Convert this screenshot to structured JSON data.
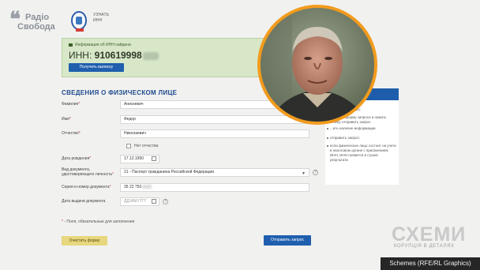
{
  "header": {
    "logo_line1": "Радіо",
    "logo_line2": "Свобода",
    "service_line1": "УЗНАТЬ",
    "service_line2": "ИНН"
  },
  "info_box": {
    "title": "Информация об ИНН найдена",
    "inn_label": "ИНН:",
    "inn_value": "910619998",
    "button": "Получить выписку"
  },
  "form": {
    "section_title": "СВЕДЕНИЯ О ФИЗИЧЕСКОМ ЛИЦЕ",
    "fields": [
      {
        "label": "Фамилия",
        "value": "Анискевич"
      },
      {
        "label": "Имя",
        "value": "Федор"
      },
      {
        "label": "Отчество",
        "value": "Николаевич"
      },
      {
        "label": "Дата рождения",
        "value": "17.12.1950"
      },
      {
        "label": "Вид документа, удостоверяющего личность",
        "value": "21 - Паспорт гражданина Российской Федерации"
      },
      {
        "label": "Серия и номер документа",
        "value": "35 22 750"
      },
      {
        "label": "Дата выдачи документа",
        "value": "ДД.ММ.ГГГГ"
      }
    ],
    "no_patronymic": "Нет отчества",
    "required_note": "- Поля, обязательные для заполнения",
    "clear_button": "Очистить форму",
    "submit_button": "Отправить запрос"
  },
  "sidebar": {
    "items": [
      "...узнать ИНН",
      "...ица необходимо:",
      "...олнить форму запроса и нажать кнопку отправить запрос",
      "...ить наличие информации",
      "отправить запрос;",
      "если физическое лицо состоит на учете в налоговом органе с присвоением ИНН, ИНН появится в строке результата"
    ]
  },
  "watermark": {
    "logo": "СХЕМИ",
    "tagline": "КОРУПЦІЯ В ДЕТАЛЯХ",
    "credit": "Schemes (RFE/RL Graphics)"
  },
  "colors": {
    "primary_blue": "#1f5fae",
    "info_green": "#d7e7c8",
    "photo_border": "#f29b1d",
    "clear_yellow": "#e7d77e"
  }
}
